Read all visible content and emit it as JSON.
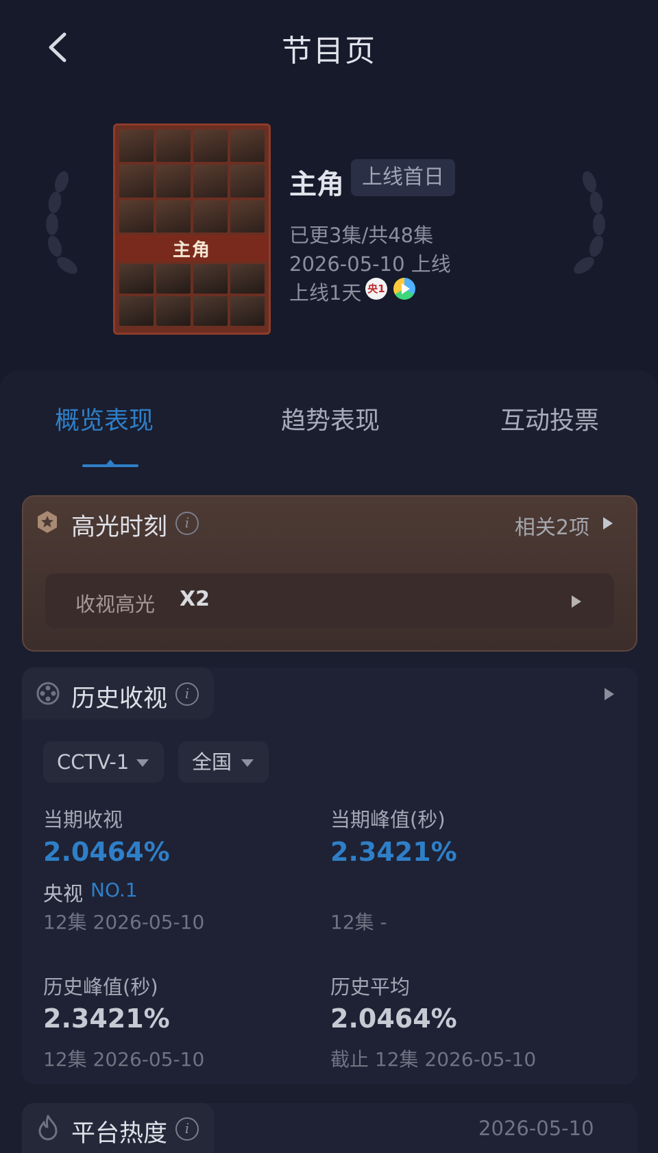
{
  "header": {
    "title": "节目页",
    "back_icon": "chevron-left-icon"
  },
  "show": {
    "poster_title": "主角",
    "name": "主角",
    "status_badge": "上线首日",
    "episodes": "已更3集/共48集",
    "release": "2026-05-10 上线",
    "days_online": "上线1天",
    "channel_badge": "央1"
  },
  "tabs": [
    {
      "label": "概览表现",
      "active": true
    },
    {
      "label": "趋势表现",
      "active": false
    },
    {
      "label": "互动投票",
      "active": false
    }
  ],
  "highlights": {
    "title": "高光时刻",
    "info": "i",
    "related": "相关2项",
    "row_label": "收视高光",
    "row_value": "X2"
  },
  "history": {
    "title": "历史收视",
    "info": "i",
    "filters": {
      "channel": "CCTV-1",
      "region": "全国"
    },
    "current_rating": {
      "label": "当期收视",
      "value": "2.0464%",
      "rank_label": "央视",
      "rank_value": "NO.1",
      "episode": "12集 2026-05-10"
    },
    "current_peak": {
      "label": "当期峰值(秒)",
      "value": "2.3421%",
      "episode": "12集 -"
    },
    "history_peak": {
      "label": "历史峰值(秒)",
      "value": "2.3421%",
      "episode": "12集 2026-05-10"
    },
    "history_avg": {
      "label": "历史平均",
      "value": "2.0464%",
      "episode": "截止 12集 2026-05-10"
    }
  },
  "platform_heat": {
    "title": "平台热度",
    "info": "i",
    "date": "2026-05-10"
  },
  "colors": {
    "background": "#161a2b",
    "accent_blue": "#2f7fc8",
    "highlight_card": "#4d3a34"
  }
}
